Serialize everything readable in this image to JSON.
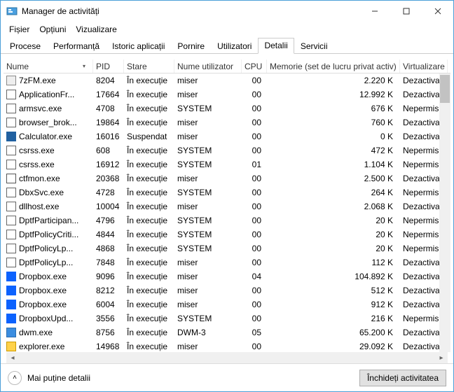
{
  "window": {
    "title": "Manager de activități"
  },
  "menu": {
    "file": "Fișier",
    "options": "Opțiuni",
    "view": "Vizualizare"
  },
  "tabs": {
    "processes": "Procese",
    "performance": "Performanță",
    "apphistory": "Istoric aplicații",
    "startup": "Pornire",
    "users": "Utilizatori",
    "details": "Detalii",
    "services": "Servicii"
  },
  "columns": {
    "name": "Nume",
    "pid": "PID",
    "state": "Stare",
    "user": "Nume utilizator",
    "cpu": "CPU",
    "mem": "Memorie (set de lucru privat activ)",
    "uac": "Virtualizare UAC"
  },
  "rows": [
    {
      "icon": "7z",
      "name": "7zFM.exe",
      "pid": "8204",
      "state": "În execuție",
      "user": "miser",
      "cpu": "00",
      "mem": "2.220 K",
      "uac": "Dezactivat"
    },
    {
      "icon": "blank",
      "name": "ApplicationFr...",
      "pid": "17664",
      "state": "În execuție",
      "user": "miser",
      "cpu": "00",
      "mem": "12.992 K",
      "uac": "Dezactivat"
    },
    {
      "icon": "blank",
      "name": "armsvc.exe",
      "pid": "4708",
      "state": "În execuție",
      "user": "SYSTEM",
      "cpu": "00",
      "mem": "676 K",
      "uac": "Nepermis"
    },
    {
      "icon": "blank",
      "name": "browser_brok...",
      "pid": "19864",
      "state": "În execuție",
      "user": "miser",
      "cpu": "00",
      "mem": "760 K",
      "uac": "Dezactivat"
    },
    {
      "icon": "calc",
      "name": "Calculator.exe",
      "pid": "16016",
      "state": "Suspendat",
      "user": "miser",
      "cpu": "00",
      "mem": "0 K",
      "uac": "Dezactivat"
    },
    {
      "icon": "blank",
      "name": "csrss.exe",
      "pid": "608",
      "state": "În execuție",
      "user": "SYSTEM",
      "cpu": "00",
      "mem": "472 K",
      "uac": "Nepermis"
    },
    {
      "icon": "blank",
      "name": "csrss.exe",
      "pid": "16912",
      "state": "În execuție",
      "user": "SYSTEM",
      "cpu": "01",
      "mem": "1.104 K",
      "uac": "Nepermis"
    },
    {
      "icon": "ctf",
      "name": "ctfmon.exe",
      "pid": "20368",
      "state": "În execuție",
      "user": "miser",
      "cpu": "00",
      "mem": "2.500 K",
      "uac": "Dezactivat"
    },
    {
      "icon": "blank",
      "name": "DbxSvc.exe",
      "pid": "4728",
      "state": "În execuție",
      "user": "SYSTEM",
      "cpu": "00",
      "mem": "264 K",
      "uac": "Nepermis"
    },
    {
      "icon": "blank",
      "name": "dllhost.exe",
      "pid": "10004",
      "state": "În execuție",
      "user": "miser",
      "cpu": "00",
      "mem": "2.068 K",
      "uac": "Dezactivat"
    },
    {
      "icon": "blank",
      "name": "DptfParticipan...",
      "pid": "4796",
      "state": "În execuție",
      "user": "SYSTEM",
      "cpu": "00",
      "mem": "20 K",
      "uac": "Nepermis"
    },
    {
      "icon": "blank",
      "name": "DptfPolicyCriti...",
      "pid": "4844",
      "state": "În execuție",
      "user": "SYSTEM",
      "cpu": "00",
      "mem": "20 K",
      "uac": "Nepermis"
    },
    {
      "icon": "blank",
      "name": "DptfPolicyLp...",
      "pid": "4868",
      "state": "În execuție",
      "user": "SYSTEM",
      "cpu": "00",
      "mem": "20 K",
      "uac": "Nepermis"
    },
    {
      "icon": "blank",
      "name": "DptfPolicyLp...",
      "pid": "7848",
      "state": "În execuție",
      "user": "miser",
      "cpu": "00",
      "mem": "112 K",
      "uac": "Dezactivat"
    },
    {
      "icon": "drop",
      "name": "Dropbox.exe",
      "pid": "9096",
      "state": "În execuție",
      "user": "miser",
      "cpu": "04",
      "mem": "104.892 K",
      "uac": "Dezactivat"
    },
    {
      "icon": "drop",
      "name": "Dropbox.exe",
      "pid": "8212",
      "state": "În execuție",
      "user": "miser",
      "cpu": "00",
      "mem": "512 K",
      "uac": "Dezactivat"
    },
    {
      "icon": "drop",
      "name": "Dropbox.exe",
      "pid": "6004",
      "state": "În execuție",
      "user": "miser",
      "cpu": "00",
      "mem": "912 K",
      "uac": "Dezactivat"
    },
    {
      "icon": "drop",
      "name": "DropboxUpd...",
      "pid": "3556",
      "state": "În execuție",
      "user": "SYSTEM",
      "cpu": "00",
      "mem": "216 K",
      "uac": "Nepermis"
    },
    {
      "icon": "blue",
      "name": "dwm.exe",
      "pid": "8756",
      "state": "În execuție",
      "user": "DWM-3",
      "cpu": "05",
      "mem": "65.200 K",
      "uac": "Dezactivat"
    },
    {
      "icon": "expl",
      "name": "explorer.exe",
      "pid": "14968",
      "state": "În execuție",
      "user": "miser",
      "cpu": "00",
      "mem": "29.092 K",
      "uac": "Dezactivat"
    }
  ],
  "footer": {
    "fewer": "Mai puține detalii",
    "endtask": "Închideți activitatea"
  }
}
